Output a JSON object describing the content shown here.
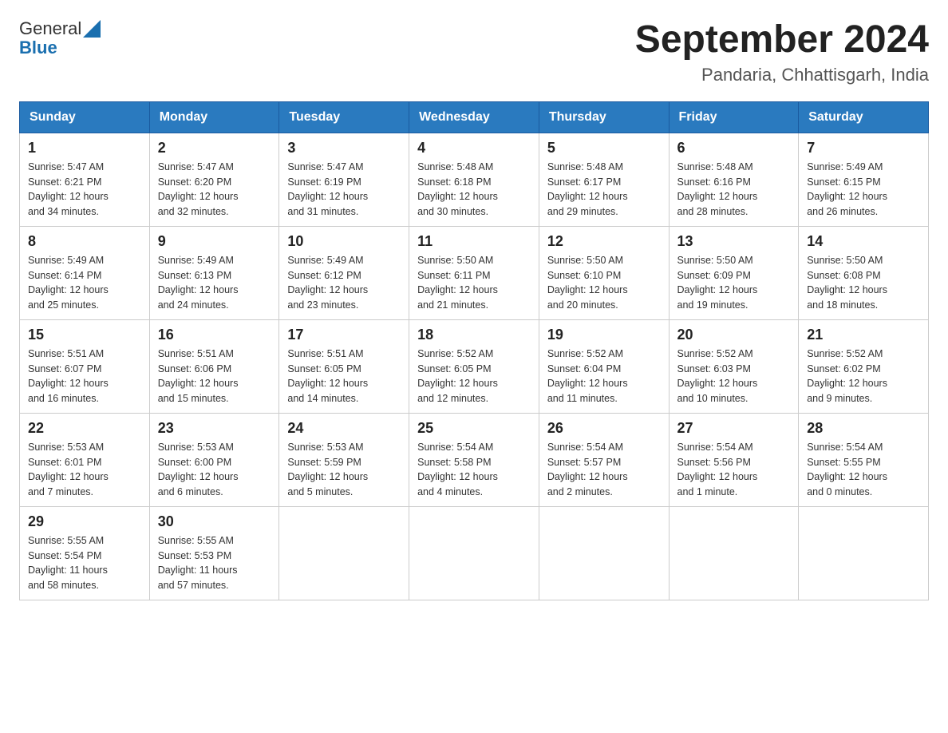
{
  "logo": {
    "general": "General",
    "blue": "Blue"
  },
  "title": "September 2024",
  "subtitle": "Pandaria, Chhattisgarh, India",
  "headers": [
    "Sunday",
    "Monday",
    "Tuesday",
    "Wednesday",
    "Thursday",
    "Friday",
    "Saturday"
  ],
  "weeks": [
    [
      {
        "day": "1",
        "sunrise": "5:47 AM",
        "sunset": "6:21 PM",
        "daylight": "12 hours and 34 minutes."
      },
      {
        "day": "2",
        "sunrise": "5:47 AM",
        "sunset": "6:20 PM",
        "daylight": "12 hours and 32 minutes."
      },
      {
        "day": "3",
        "sunrise": "5:47 AM",
        "sunset": "6:19 PM",
        "daylight": "12 hours and 31 minutes."
      },
      {
        "day": "4",
        "sunrise": "5:48 AM",
        "sunset": "6:18 PM",
        "daylight": "12 hours and 30 minutes."
      },
      {
        "day": "5",
        "sunrise": "5:48 AM",
        "sunset": "6:17 PM",
        "daylight": "12 hours and 29 minutes."
      },
      {
        "day": "6",
        "sunrise": "5:48 AM",
        "sunset": "6:16 PM",
        "daylight": "12 hours and 28 minutes."
      },
      {
        "day": "7",
        "sunrise": "5:49 AM",
        "sunset": "6:15 PM",
        "daylight": "12 hours and 26 minutes."
      }
    ],
    [
      {
        "day": "8",
        "sunrise": "5:49 AM",
        "sunset": "6:14 PM",
        "daylight": "12 hours and 25 minutes."
      },
      {
        "day": "9",
        "sunrise": "5:49 AM",
        "sunset": "6:13 PM",
        "daylight": "12 hours and 24 minutes."
      },
      {
        "day": "10",
        "sunrise": "5:49 AM",
        "sunset": "6:12 PM",
        "daylight": "12 hours and 23 minutes."
      },
      {
        "day": "11",
        "sunrise": "5:50 AM",
        "sunset": "6:11 PM",
        "daylight": "12 hours and 21 minutes."
      },
      {
        "day": "12",
        "sunrise": "5:50 AM",
        "sunset": "6:10 PM",
        "daylight": "12 hours and 20 minutes."
      },
      {
        "day": "13",
        "sunrise": "5:50 AM",
        "sunset": "6:09 PM",
        "daylight": "12 hours and 19 minutes."
      },
      {
        "day": "14",
        "sunrise": "5:50 AM",
        "sunset": "6:08 PM",
        "daylight": "12 hours and 18 minutes."
      }
    ],
    [
      {
        "day": "15",
        "sunrise": "5:51 AM",
        "sunset": "6:07 PM",
        "daylight": "12 hours and 16 minutes."
      },
      {
        "day": "16",
        "sunrise": "5:51 AM",
        "sunset": "6:06 PM",
        "daylight": "12 hours and 15 minutes."
      },
      {
        "day": "17",
        "sunrise": "5:51 AM",
        "sunset": "6:05 PM",
        "daylight": "12 hours and 14 minutes."
      },
      {
        "day": "18",
        "sunrise": "5:52 AM",
        "sunset": "6:05 PM",
        "daylight": "12 hours and 12 minutes."
      },
      {
        "day": "19",
        "sunrise": "5:52 AM",
        "sunset": "6:04 PM",
        "daylight": "12 hours and 11 minutes."
      },
      {
        "day": "20",
        "sunrise": "5:52 AM",
        "sunset": "6:03 PM",
        "daylight": "12 hours and 10 minutes."
      },
      {
        "day": "21",
        "sunrise": "5:52 AM",
        "sunset": "6:02 PM",
        "daylight": "12 hours and 9 minutes."
      }
    ],
    [
      {
        "day": "22",
        "sunrise": "5:53 AM",
        "sunset": "6:01 PM",
        "daylight": "12 hours and 7 minutes."
      },
      {
        "day": "23",
        "sunrise": "5:53 AM",
        "sunset": "6:00 PM",
        "daylight": "12 hours and 6 minutes."
      },
      {
        "day": "24",
        "sunrise": "5:53 AM",
        "sunset": "5:59 PM",
        "daylight": "12 hours and 5 minutes."
      },
      {
        "day": "25",
        "sunrise": "5:54 AM",
        "sunset": "5:58 PM",
        "daylight": "12 hours and 4 minutes."
      },
      {
        "day": "26",
        "sunrise": "5:54 AM",
        "sunset": "5:57 PM",
        "daylight": "12 hours and 2 minutes."
      },
      {
        "day": "27",
        "sunrise": "5:54 AM",
        "sunset": "5:56 PM",
        "daylight": "12 hours and 1 minute."
      },
      {
        "day": "28",
        "sunrise": "5:54 AM",
        "sunset": "5:55 PM",
        "daylight": "12 hours and 0 minutes."
      }
    ],
    [
      {
        "day": "29",
        "sunrise": "5:55 AM",
        "sunset": "5:54 PM",
        "daylight": "11 hours and 58 minutes."
      },
      {
        "day": "30",
        "sunrise": "5:55 AM",
        "sunset": "5:53 PM",
        "daylight": "11 hours and 57 minutes."
      },
      null,
      null,
      null,
      null,
      null
    ]
  ],
  "labels": {
    "sunrise": "Sunrise:",
    "sunset": "Sunset:",
    "daylight": "Daylight:"
  }
}
